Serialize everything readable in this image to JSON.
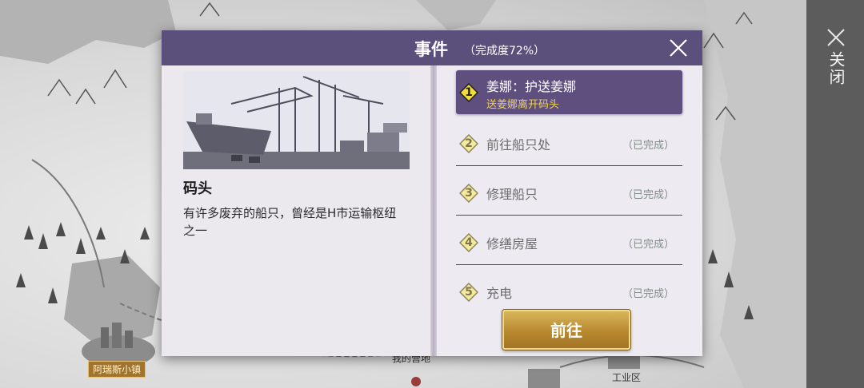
{
  "map": {
    "labels": {
      "camp": "我的营地",
      "industrial": "工业区"
    },
    "town_label": "阿瑞斯小镇"
  },
  "side": {
    "close_label": "关闭"
  },
  "dialog": {
    "title": "事件",
    "progress": "（完成度72%）",
    "location": {
      "name": "码头",
      "description": "有许多废弃的船只，曾经是H市运输枢纽之一",
      "image_icon": "harbor-cranes-ship-illustration"
    },
    "quests": [
      {
        "number": "1",
        "title": "姜娜：护送姜娜",
        "subtitle": "送姜娜离开码头",
        "status": ""
      },
      {
        "number": "2",
        "title": "前往船只处",
        "subtitle": "",
        "status": "（已完成）"
      },
      {
        "number": "3",
        "title": "修理船只",
        "subtitle": "",
        "status": "（已完成）"
      },
      {
        "number": "4",
        "title": "修缮房屋",
        "subtitle": "",
        "status": "（已完成）"
      },
      {
        "number": "5",
        "title": "充电",
        "subtitle": "",
        "status": "（已完成）"
      }
    ],
    "go_label": "前往"
  },
  "colors": {
    "header": "#5b4f7c",
    "active_quest": "#5e4f7f",
    "quest_subtitle": "#f3d645",
    "accent_diamond": "#f2dc3c",
    "button_gold": "#b8892e"
  }
}
